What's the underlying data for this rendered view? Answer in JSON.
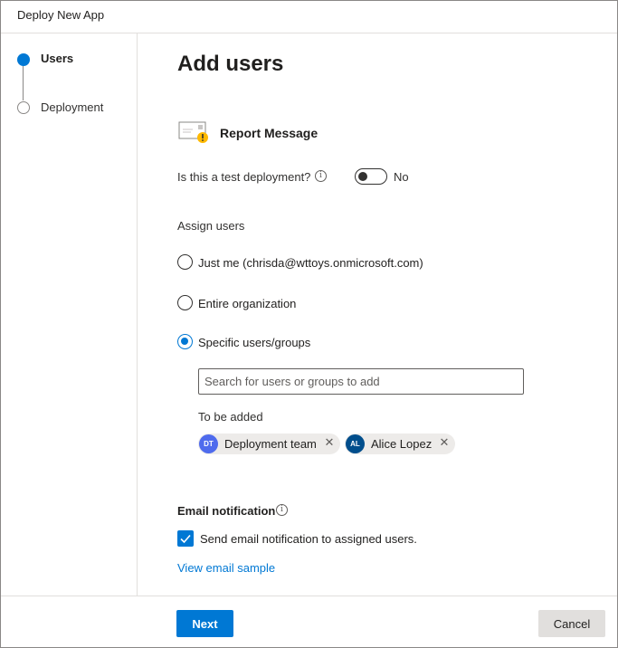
{
  "window": {
    "title": "Deploy New App"
  },
  "steps": [
    {
      "label": "Users",
      "state": "active"
    },
    {
      "label": "Deployment",
      "state": "inactive"
    }
  ],
  "main": {
    "title": "Add users",
    "app": {
      "name": "Report Message",
      "icon": "envelope-warning-icon"
    },
    "test_deployment": {
      "label": "Is this a test deployment?",
      "value": "No",
      "enabled": false
    },
    "assign_users": {
      "label": "Assign users",
      "options": [
        {
          "label": "Just me (chrisda@wttoys.onmicrosoft.com)",
          "selected": false
        },
        {
          "label": "Entire organization",
          "selected": false
        },
        {
          "label": "Specific users/groups",
          "selected": true
        }
      ]
    },
    "search": {
      "placeholder": "Search for users or groups to add",
      "value": ""
    },
    "to_be_added": {
      "label": "To be added",
      "items": [
        {
          "initials": "DT",
          "name": "Deployment team",
          "color": "#4f6bed"
        },
        {
          "initials": "AL",
          "name": "Alice Lopez",
          "color": "#004e8c"
        }
      ]
    },
    "email_notification": {
      "title": "Email notification",
      "checkbox_label": "Send email notification to assigned users.",
      "checked": true,
      "link": "View email sample"
    }
  },
  "footer": {
    "next_label": "Next",
    "cancel_label": "Cancel"
  },
  "colors": {
    "accent": "#0078d4",
    "border": "#e1dfdd"
  }
}
